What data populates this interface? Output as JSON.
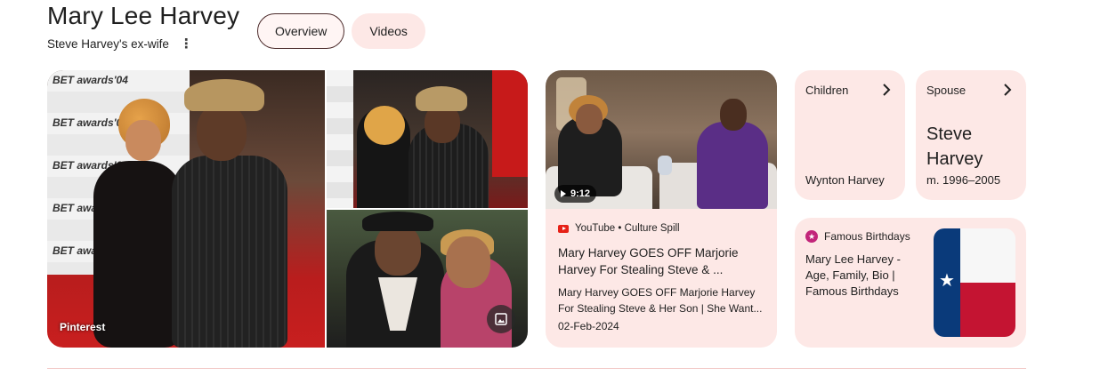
{
  "header": {
    "title": "Mary Lee Harvey",
    "subtitle": "Steve Harvey's ex-wife"
  },
  "tabs": [
    {
      "label": "Overview",
      "active": true
    },
    {
      "label": "Videos",
      "active": false
    }
  ],
  "images": {
    "source_label": "Pinterest",
    "wall_logo_text": "BET awards'04"
  },
  "video": {
    "duration": "9:12",
    "source": "YouTube • Culture Spill",
    "title": "Mary Harvey GOES OFF Marjorie Harvey For Stealing Steve & ...",
    "description": "Mary Harvey GOES OFF Marjorie Harvey For Stealing Steve & Her Son | She Want...",
    "date": "02-Feb-2024"
  },
  "children": {
    "label": "Children",
    "value": "Wynton Harvey"
  },
  "spouse": {
    "label": "Spouse",
    "name": "Steve Harvey",
    "years": "m. 1996–2005"
  },
  "birthday_card": {
    "source": "Famous Birthdays",
    "title": "Mary Lee Harvey - Age, Family, Bio | Famous Birthdays"
  },
  "colors": {
    "card_bg": "#fde8e6",
    "youtube_red": "#e62117",
    "famous_birthdays_pink": "#c2257a"
  },
  "icons": {
    "more": "kebab-menu-icon",
    "chevron": "chevron-right-icon",
    "image": "image-icon",
    "play": "play-icon"
  }
}
